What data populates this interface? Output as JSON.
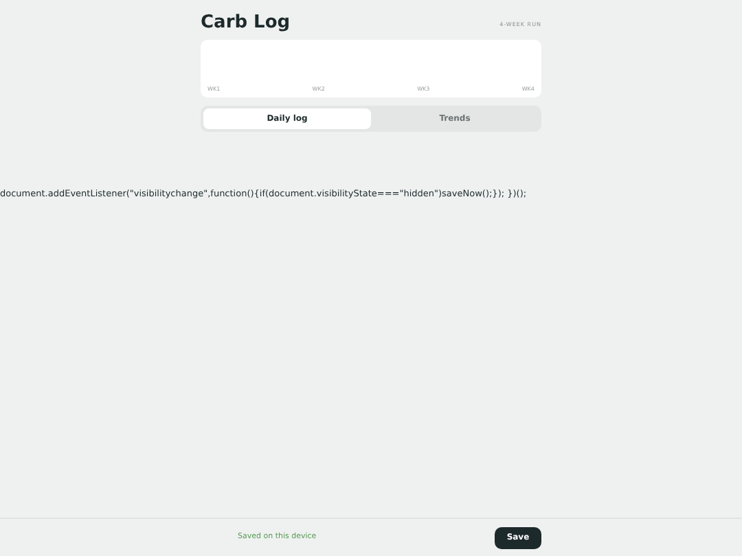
{
  "header": {
    "title": "Carb Log",
    "caption": "4-WEEK RUN"
  },
  "chart": {
    "week_labels": [
      "WK1",
      "WK2",
      "WK3",
      "WK4"
    ]
  },
  "tabs": [
    {
      "label": "Daily log",
      "selected": true
    },
    {
      "label": "Trends",
      "selected": false
    }
  ],
  "stray_text": "document.addEventListener(\"visibilitychange\",function(){if(document.visibilityState===\"hidden\")saveNow();}); })();",
  "footer": {
    "status": "Saved on this device",
    "button": "Save"
  }
}
